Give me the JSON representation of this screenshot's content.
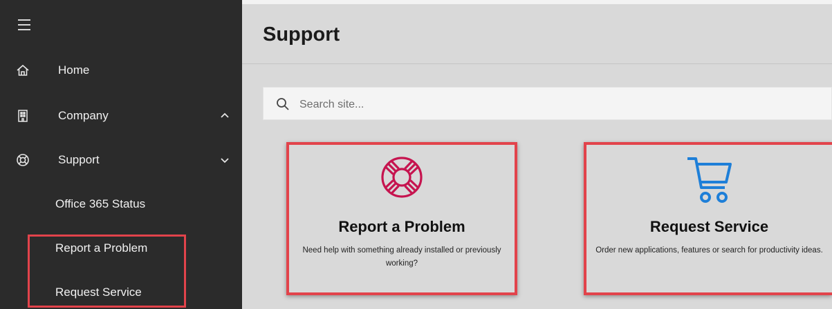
{
  "sidebar": {
    "items": [
      {
        "label": "Home",
        "icon": "home-icon"
      },
      {
        "label": "Company",
        "icon": "building-icon",
        "chevron": "up"
      },
      {
        "label": "Support",
        "icon": "lifebuoy-icon",
        "chevron": "down"
      }
    ],
    "sub_items": [
      {
        "label": "Office 365 Status"
      },
      {
        "label": "Report a Problem"
      },
      {
        "label": "Request Service"
      }
    ]
  },
  "main": {
    "title": "Support",
    "search": {
      "placeholder": "Search site..."
    },
    "cards": [
      {
        "title": "Report a Problem",
        "description": "Need help with something already installed or previously working?",
        "icon": "lifebuoy-icon",
        "icon_color": "#c6144f"
      },
      {
        "title": "Request Service",
        "description": "Order new applications, features or search for productivity ideas.",
        "icon": "shopping-cart-icon",
        "icon_color": "#1e7fd8"
      }
    ]
  },
  "colors": {
    "sidebar_bg": "#2b2b2b",
    "main_bg": "#d9d9d9",
    "highlight": "#e2434b"
  }
}
